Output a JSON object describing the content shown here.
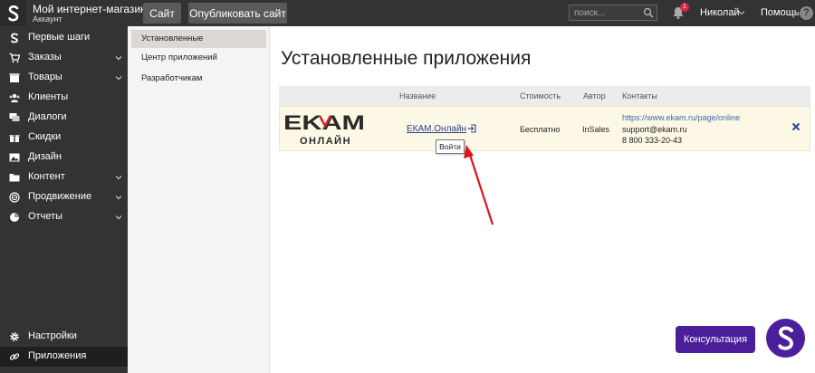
{
  "header": {
    "shop_title": "Мой интернет-магазин",
    "shop_subtitle": "Аккаунт",
    "site_button": "Сайт",
    "publish_button": "Опубликовать сайт",
    "search_placeholder": "поиск...",
    "notifications_count": "1",
    "user_name": "Николай",
    "help_label": "Помощь",
    "help_glyph": "?"
  },
  "sidebar": {
    "items": [
      {
        "label": "Первые шаги",
        "icon": "stripes-icon"
      },
      {
        "label": "Заказы",
        "icon": "cart-icon"
      },
      {
        "label": "Товары",
        "icon": "box-icon"
      },
      {
        "label": "Клиенты",
        "icon": "users-icon"
      },
      {
        "label": "Диалоги",
        "icon": "chat-icon"
      },
      {
        "label": "Скидки",
        "icon": "gift-icon"
      },
      {
        "label": "Дизайн",
        "icon": "image-icon"
      },
      {
        "label": "Контент",
        "icon": "folder-icon"
      },
      {
        "label": "Продвижение",
        "icon": "target-icon"
      },
      {
        "label": "Отчеты",
        "icon": "pie-icon"
      }
    ],
    "settings_label": "Настройки",
    "apps_label": "Приложения"
  },
  "submenu": {
    "items": [
      "Установленные",
      "Центр приложений",
      "Разработчикам"
    ]
  },
  "main": {
    "title": "Установленные приложения",
    "columns": [
      "Название",
      "Стоимость",
      "Автор",
      "Контакты"
    ],
    "row": {
      "logo_top": "EKAM",
      "logo_bottom": "ОНЛАЙН",
      "name": "ЕКАМ.Онлайн",
      "cost": "Бесплатно",
      "author": "InSales",
      "contact_url": "https://www.ekam.ru/page/online",
      "contact_email": "support@ekam.ru",
      "contact_phone": "8 800 333-20-43"
    },
    "tooltip": "Войти"
  },
  "consult_button": "Консультация",
  "colors": {
    "topbar": "#333334",
    "accent_purple": "#4b1e9c",
    "row_highlight": "#fdf8e6",
    "arrow_red": "#e0141e"
  }
}
